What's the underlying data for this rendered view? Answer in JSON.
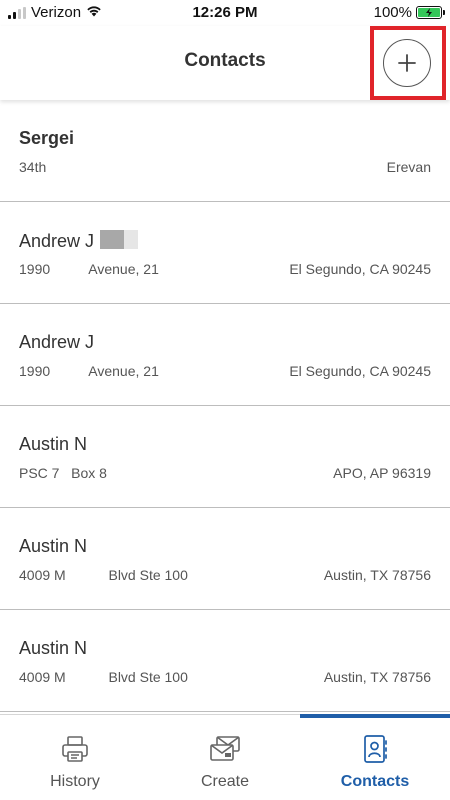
{
  "status_bar": {
    "carrier": "Verizon",
    "time": "12:26 PM",
    "battery": "100%",
    "battery_color": "#34c759"
  },
  "nav": {
    "title": "Contacts",
    "add_icon": "plus-icon",
    "highlight_color": "#e0242a"
  },
  "contacts": [
    {
      "name": "Sergei",
      "street": "34th",
      "city": "Erevan"
    },
    {
      "name": "Andrew J",
      "street": "1990          Avenue, 21",
      "city": "El Segundo, CA 90245"
    },
    {
      "name": "Andrew J",
      "street": "1990          Avenue, 21",
      "city": "El Segundo, CA 90245"
    },
    {
      "name": "Austin N",
      "street": "PSC 7   Box 8",
      "city": "APO, AP 96319"
    },
    {
      "name": "Austin N",
      "street": "4009 M           Blvd Ste 100",
      "city": "Austin, TX 78756"
    },
    {
      "name": "Austin N",
      "street": "4009 M           Blvd Ste 100",
      "city": "Austin, TX 78756"
    }
  ],
  "tabs": [
    {
      "label": "History",
      "icon": "printer-icon",
      "active": false
    },
    {
      "label": "Create",
      "icon": "envelope-icon",
      "active": false
    },
    {
      "label": "Contacts",
      "icon": "contact-card-icon",
      "active": true
    }
  ],
  "colors": {
    "accent": "#1f5ea8",
    "text": "#333333"
  }
}
